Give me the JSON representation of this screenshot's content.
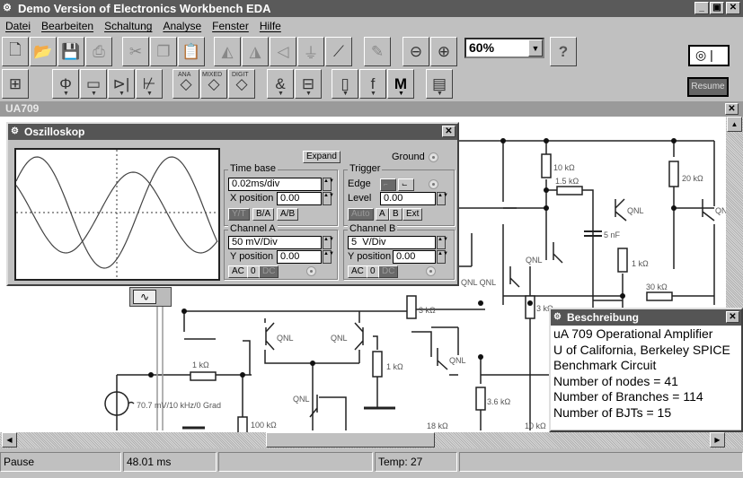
{
  "app": {
    "title": "Demo Version of Electronics Workbench EDA"
  },
  "menu": [
    "Datei",
    "Bearbeiten",
    "Schaltung",
    "Analyse",
    "Fenster",
    "Hilfe"
  ],
  "toolbar": {
    "zoom_value": "60%",
    "help_label": "?",
    "resume_label": "Resume",
    "parts": {
      "ana": "ANA",
      "mixed": "MIXED",
      "digit": "DIGIT",
      "misc": "M"
    }
  },
  "document": {
    "title": "UA709"
  },
  "oscilloscope": {
    "title": "Oszilloskop",
    "expand_label": "Expand",
    "ground_label": "Ground",
    "time_base": {
      "label": "Time base",
      "value": "0.02ms/div",
      "xpos_label": "X position",
      "xpos": "0.00",
      "modes": [
        "Y/T",
        "B/A",
        "A/B"
      ]
    },
    "trigger": {
      "label": "Trigger",
      "edge_label": "Edge",
      "level_label": "Level",
      "level": "0.00",
      "sources": [
        "Auto",
        "A",
        "B",
        "Ext"
      ]
    },
    "channel_a": {
      "label": "Channel A",
      "value": "50 mV/Div",
      "ypos_label": "Y position",
      "ypos": "0.00",
      "coupling": [
        "AC",
        "0",
        "DC"
      ]
    },
    "channel_b": {
      "label": "Channel B",
      "value": "5  V/Div",
      "ypos_label": "Y position",
      "ypos": "0.00",
      "coupling": [
        "AC",
        "0",
        "DC"
      ]
    }
  },
  "description": {
    "title": "Beschreibung",
    "lines": [
      "uA 709 Operational Amplifier",
      "U of California,  Berkeley SPICE",
      "Benchmark Circuit",
      "Number of nodes = 41",
      "Number of Branches = 114",
      "Number of BJTs = 15"
    ]
  },
  "circuit": {
    "labels": [
      "10 kΩ",
      "1.5 kΩ",
      "20 kΩ",
      "QNL",
      "QNL",
      "5 nF",
      "1 kΩ",
      "30 kΩ",
      "QNL",
      "QNL QNL",
      "3 kΩ",
      "3 kΩ",
      "QNL",
      "QNL",
      "1 kΩ",
      "1 kΩ",
      "QNL",
      "QNL",
      "3.6 kΩ",
      "70.7 mV/10 kHz/0 Grad",
      "18 kΩ",
      "10 kΩ",
      "100 kΩ"
    ]
  },
  "status": {
    "state": "Pause",
    "time": "48.01 ms",
    "temp": "Temp:  27"
  }
}
